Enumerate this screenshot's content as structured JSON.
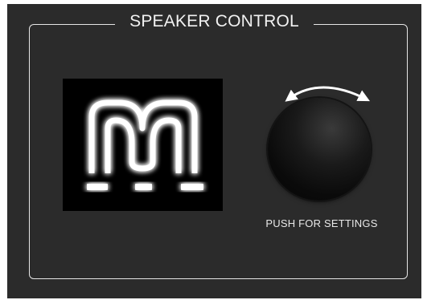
{
  "panel": {
    "title": "SPEAKER CONTROL",
    "logo": {
      "icon": "m-logo-icon",
      "color": "#ffffff",
      "background": "#000000"
    },
    "knob": {
      "icon": "rotate-arrows-icon",
      "label": "PUSH FOR SETTINGS"
    },
    "colors": {
      "panel_background": "#2b2b2b",
      "frame_line": "#e6e6e6",
      "text": "#f2f2f2"
    }
  }
}
